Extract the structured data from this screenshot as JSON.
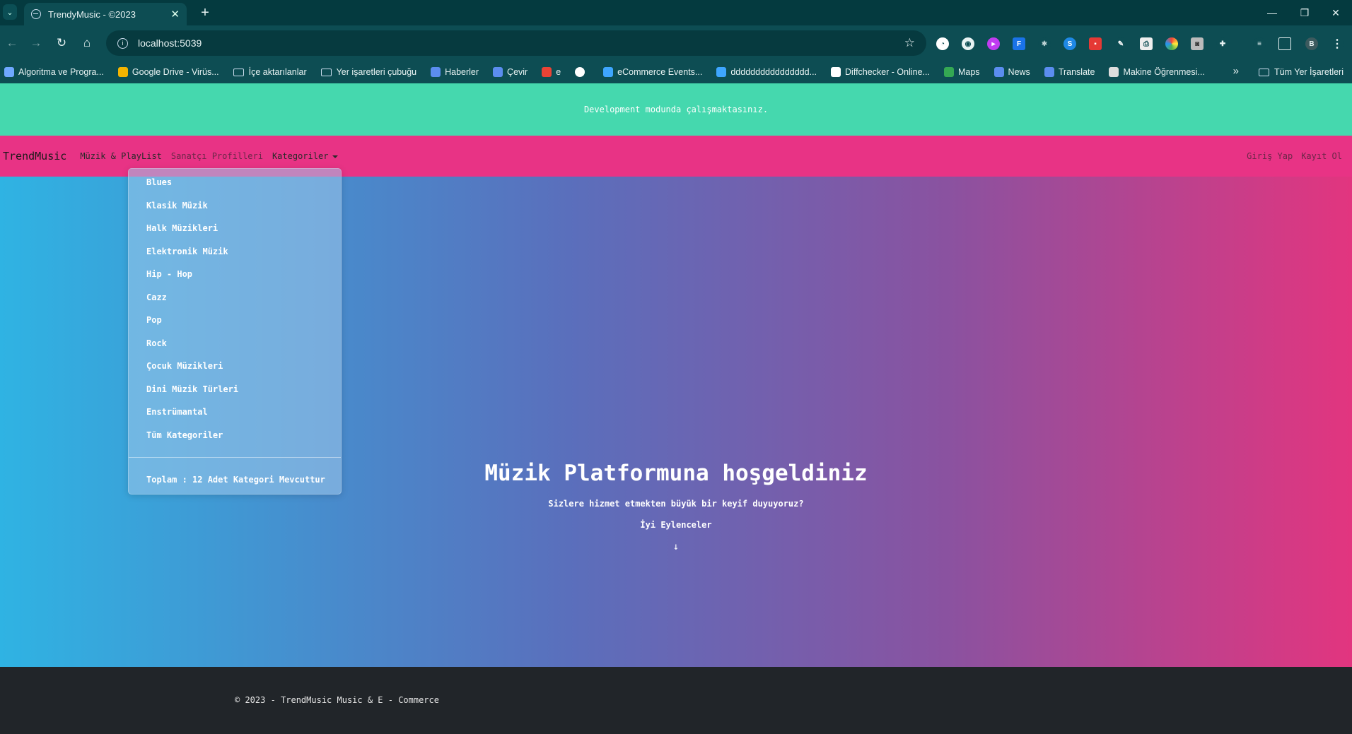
{
  "browser": {
    "tab_title": "TrendyMusic - ©2023",
    "url": "localhost:5039",
    "profile_initial": "B",
    "bookmarks": [
      {
        "label": "Algoritma ve Progra...",
        "icon": "bookmark-icon",
        "color": "#6fa8ff"
      },
      {
        "label": "Google Drive - Virüs...",
        "icon": "drive-icon",
        "color": "#f4b400"
      },
      {
        "label": "İçe aktarılanlar",
        "icon": "folder-icon",
        "color": ""
      },
      {
        "label": "Yer işaretleri çubuğu",
        "icon": "folder-icon",
        "color": ""
      },
      {
        "label": "Haberler",
        "icon": "news-icon",
        "color": "#5b8def"
      },
      {
        "label": "Çevir",
        "icon": "translate-icon",
        "color": "#5b8def"
      },
      {
        "label": "e",
        "icon": "mail-icon",
        "color": "#ea4335"
      },
      {
        "label": "",
        "icon": "globe-icon",
        "color": "#ffffff"
      },
      {
        "label": "eCommerce Events...",
        "icon": "k-icon",
        "color": "#3ea6ff"
      },
      {
        "label": "dddddddddddddddd...",
        "icon": "k-icon",
        "color": "#3ea6ff"
      },
      {
        "label": "Diffchecker - Online...",
        "icon": "diffchecker-icon",
        "color": "#ffffff"
      },
      {
        "label": "Maps",
        "icon": "maps-icon",
        "color": "#34a853"
      },
      {
        "label": "News",
        "icon": "news-icon",
        "color": "#5b8def"
      },
      {
        "label": "Translate",
        "icon": "translate-icon",
        "color": "#5b8def"
      },
      {
        "label": "Makine Öğrenmesi...",
        "icon": "wordpress-icon",
        "color": "#dddddd"
      }
    ],
    "all_bookmarks": "Tüm Yer İşaretleri"
  },
  "page": {
    "dev_banner": "Development modunda çalışmaktasınız.",
    "nav": {
      "brand": "TrendMusic",
      "music_playlist": "Müzik & PlayList",
      "artist_profiles": "Sanatçı Profilleri",
      "categories": "Kategoriler",
      "login": "Giriş Yap",
      "register": "Kayıt Ol"
    },
    "dropdown": {
      "items": [
        "Blues",
        "Klasik Müzik",
        "Halk Müzikleri",
        "Elektronik Müzik",
        "Hip - Hop",
        "Cazz",
        "Pop",
        "Rock",
        "Çocuk Müzikleri",
        "Dini Müzik Türleri",
        "Enstrümantal",
        "Tüm Kategoriler"
      ],
      "total": "Toplam : 12 Adet Kategori Mevcuttur"
    },
    "hero": {
      "title": "Müzik Platformuna hoşgeldiniz",
      "subtitle": "Sizlere hizmet etmekten büyük bir keyif duyuyoruz?",
      "wish": "İyi Eylenceler",
      "arrow": "↓"
    },
    "footer": "© 2023 - TrendMusic Music & E - Commerce"
  }
}
